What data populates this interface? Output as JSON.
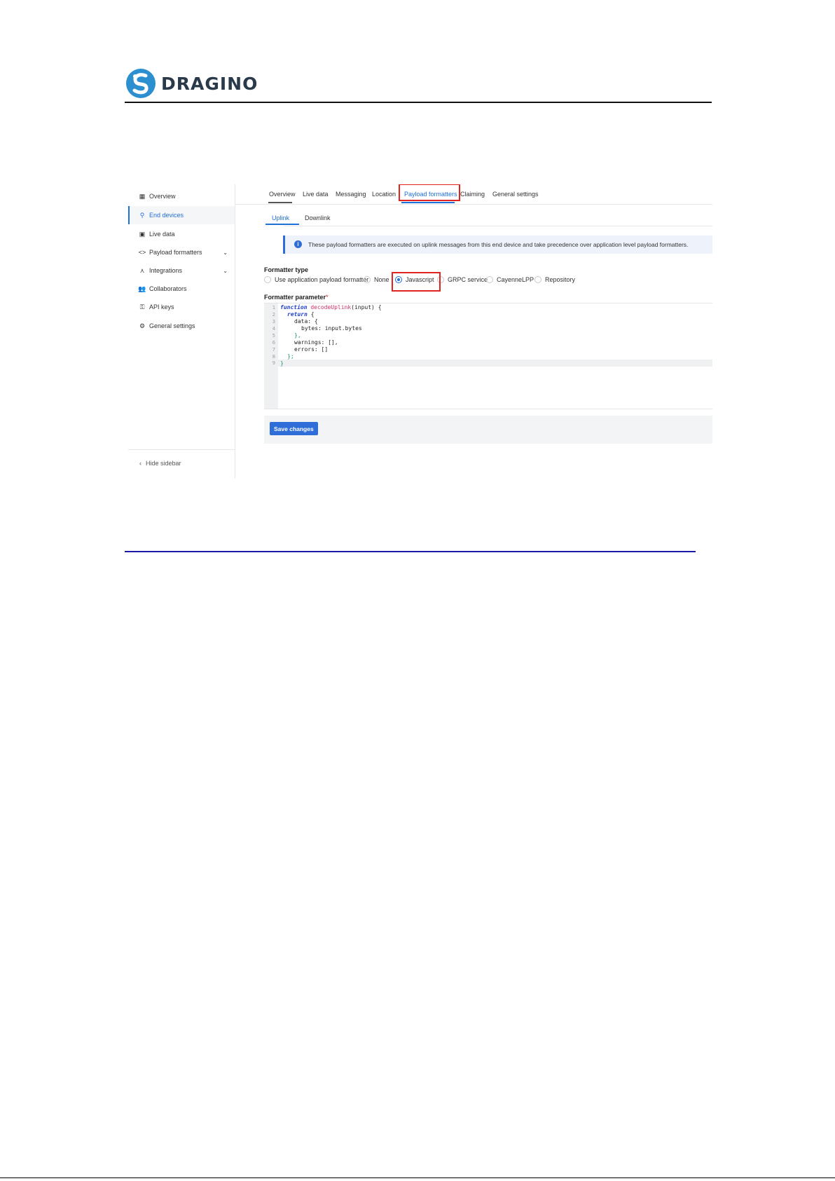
{
  "header": {
    "logo_text": "DRAGINO"
  },
  "sidebar": {
    "items": [
      {
        "label": "Overview",
        "icon": "grid-icon"
      },
      {
        "label": "End devices",
        "icon": "network-icon",
        "active": true
      },
      {
        "label": "Live data",
        "icon": "chart-icon"
      },
      {
        "label": "Payload formatters",
        "icon": "code-icon"
      },
      {
        "label": "Integrations",
        "icon": "integration-icon"
      },
      {
        "label": "Collaborators",
        "icon": "people-icon"
      },
      {
        "label": "API keys",
        "icon": "key-icon"
      },
      {
        "label": "General settings",
        "icon": "gear-icon"
      }
    ],
    "hide_label": "Hide sidebar"
  },
  "tabs": [
    "Overview",
    "Live data",
    "Messaging",
    "Location",
    "Payload formatters",
    "Claiming",
    "General settings"
  ],
  "active_tab": "Payload formatters",
  "subtabs": [
    "Uplink",
    "Downlink"
  ],
  "active_subtab": "Uplink",
  "notice": "These payload formatters are executed on uplink messages from this end device and take precedence over application level payload formatters.",
  "formatter_type": {
    "label": "Formatter type",
    "options": [
      "Use application payload formatter",
      "None",
      "Javascript",
      "GRPC service",
      "CayenneLPP",
      "Repository"
    ],
    "selected": "Javascript"
  },
  "formatter_parameter": {
    "label": "Formatter parameter",
    "required_mark": "*",
    "line_numbers": [
      "1",
      "2",
      "3",
      "4",
      "5",
      "6",
      "7",
      "8",
      "9"
    ],
    "code": {
      "l1_kw": "function",
      "l1_fn": "decodeUplink",
      "l1_rest": "(input) {",
      "l2_kw": "return",
      "l2_rest": " {",
      "l3": "data: {",
      "l4": "bytes: input.bytes",
      "l5": "},",
      "l6": "warnings: [],",
      "l7": "errors: []",
      "l8": "};",
      "l9": "}"
    }
  },
  "save_label": "Save changes",
  "colors": {
    "accent": "#1e6fd9",
    "highlight_box": "#e0231e",
    "footer_rule": "#1a1aa6"
  }
}
